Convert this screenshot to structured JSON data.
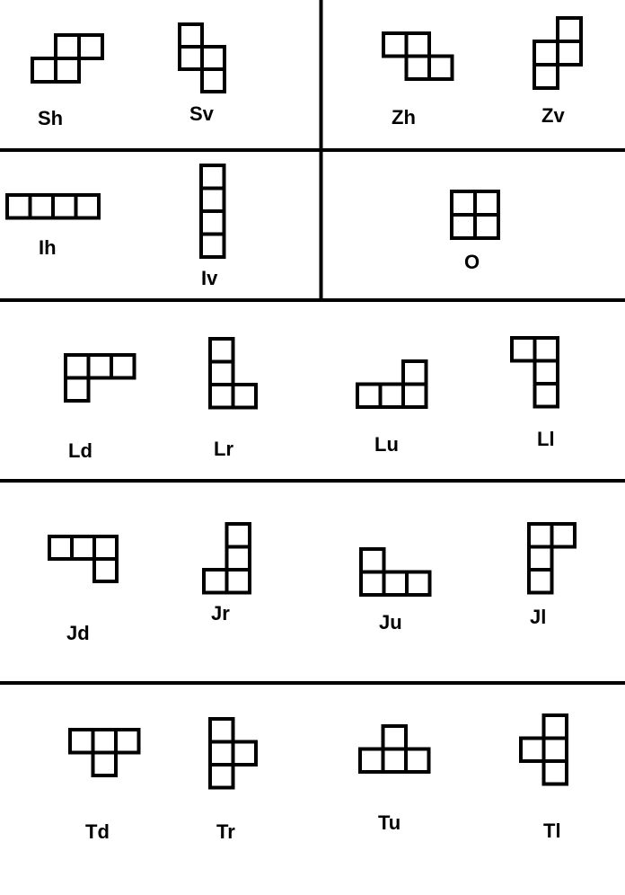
{
  "colors": {
    "background": "#ffffff",
    "ink": "#000000"
  },
  "pieces": [
    {
      "name": "Sh",
      "cells": [
        [
          1,
          0
        ],
        [
          2,
          0
        ],
        [
          0,
          1
        ],
        [
          1,
          1
        ]
      ]
    },
    {
      "name": "Sv",
      "cells": [
        [
          0,
          0
        ],
        [
          0,
          1
        ],
        [
          1,
          1
        ],
        [
          1,
          2
        ]
      ]
    },
    {
      "name": "Zh",
      "cells": [
        [
          0,
          0
        ],
        [
          1,
          0
        ],
        [
          1,
          1
        ],
        [
          2,
          1
        ]
      ]
    },
    {
      "name": "Zv",
      "cells": [
        [
          1,
          0
        ],
        [
          0,
          1
        ],
        [
          1,
          1
        ],
        [
          0,
          2
        ]
      ]
    },
    {
      "name": "Ih",
      "cells": [
        [
          0,
          0
        ],
        [
          1,
          0
        ],
        [
          2,
          0
        ],
        [
          3,
          0
        ]
      ]
    },
    {
      "name": "Iv",
      "cells": [
        [
          0,
          0
        ],
        [
          0,
          1
        ],
        [
          0,
          2
        ],
        [
          0,
          3
        ]
      ]
    },
    {
      "name": "O",
      "cells": [
        [
          0,
          0
        ],
        [
          1,
          0
        ],
        [
          0,
          1
        ],
        [
          1,
          1
        ]
      ]
    },
    {
      "name": "Ld",
      "cells": [
        [
          0,
          0
        ],
        [
          1,
          0
        ],
        [
          2,
          0
        ],
        [
          0,
          1
        ]
      ]
    },
    {
      "name": "Lr",
      "cells": [
        [
          0,
          0
        ],
        [
          0,
          1
        ],
        [
          0,
          2
        ],
        [
          1,
          2
        ]
      ]
    },
    {
      "name": "Lu",
      "cells": [
        [
          2,
          0
        ],
        [
          0,
          1
        ],
        [
          1,
          1
        ],
        [
          2,
          1
        ]
      ]
    },
    {
      "name": "Ll",
      "cells": [
        [
          0,
          0
        ],
        [
          1,
          0
        ],
        [
          1,
          1
        ],
        [
          1,
          2
        ]
      ]
    },
    {
      "name": "Jd",
      "cells": [
        [
          0,
          0
        ],
        [
          1,
          0
        ],
        [
          2,
          0
        ],
        [
          2,
          1
        ]
      ]
    },
    {
      "name": "Jr",
      "cells": [
        [
          1,
          0
        ],
        [
          1,
          1
        ],
        [
          0,
          2
        ],
        [
          1,
          2
        ]
      ]
    },
    {
      "name": "Ju",
      "cells": [
        [
          0,
          0
        ],
        [
          0,
          1
        ],
        [
          1,
          1
        ],
        [
          2,
          1
        ]
      ]
    },
    {
      "name": "Jl",
      "cells": [
        [
          0,
          0
        ],
        [
          1,
          0
        ],
        [
          0,
          1
        ],
        [
          0,
          2
        ]
      ]
    },
    {
      "name": "Td",
      "cells": [
        [
          0,
          0
        ],
        [
          1,
          0
        ],
        [
          2,
          0
        ],
        [
          1,
          1
        ]
      ]
    },
    {
      "name": "Tr",
      "cells": [
        [
          0,
          0
        ],
        [
          0,
          1
        ],
        [
          1,
          1
        ],
        [
          0,
          2
        ]
      ]
    },
    {
      "name": "Tu",
      "cells": [
        [
          1,
          0
        ],
        [
          0,
          1
        ],
        [
          1,
          1
        ],
        [
          2,
          1
        ]
      ]
    },
    {
      "name": "Tl",
      "cells": [
        [
          1,
          0
        ],
        [
          0,
          1
        ],
        [
          1,
          1
        ],
        [
          1,
          2
        ]
      ]
    }
  ]
}
